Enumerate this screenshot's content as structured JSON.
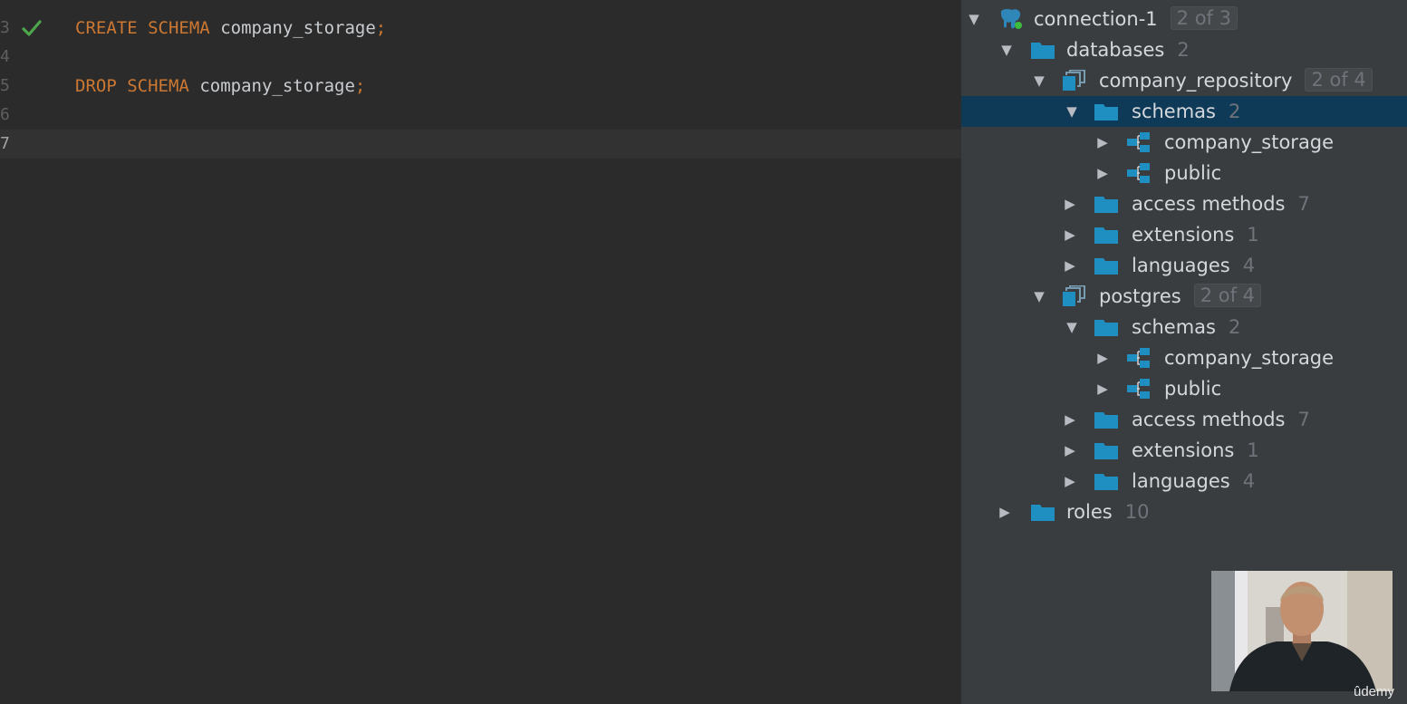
{
  "editor": {
    "lines": [
      {
        "num": "3",
        "keyword1": "CREATE",
        "keyword2": "SCHEMA",
        "identifier": "company_storage",
        "punct": ";",
        "status": "executed"
      },
      {
        "num": "4"
      },
      {
        "num": "5",
        "keyword1": "DROP",
        "keyword2": "SCHEMA",
        "identifier": "company_storage",
        "punct": ";"
      },
      {
        "num": "6"
      },
      {
        "num": "7"
      }
    ]
  },
  "tree": {
    "connection": {
      "label": "connection-1",
      "badge": "2 of 3"
    },
    "databases": {
      "label": "databases",
      "count": "2"
    },
    "db1": {
      "label": "company_repository",
      "badge": "2 of 4",
      "schemas": {
        "label": "schemas",
        "count": "2"
      },
      "schema1": "company_storage",
      "schema2": "public",
      "access_methods": {
        "label": "access methods",
        "count": "7"
      },
      "extensions": {
        "label": "extensions",
        "count": "1"
      },
      "languages": {
        "label": "languages",
        "count": "4"
      }
    },
    "db2": {
      "label": "postgres",
      "badge": "2 of 4",
      "schemas": {
        "label": "schemas",
        "count": "2"
      },
      "schema1": "company_storage",
      "schema2": "public",
      "access_methods": {
        "label": "access methods",
        "count": "7"
      },
      "extensions": {
        "label": "extensions",
        "count": "1"
      },
      "languages": {
        "label": "languages",
        "count": "4"
      }
    },
    "roles": {
      "label": "roles",
      "count": "10"
    }
  },
  "overlay": {
    "watermark": "ûdemy"
  },
  "colors": {
    "keyword": "#cc7832",
    "folder": "#1f8fc1",
    "selection": "#0e3a58",
    "check": "#4ca64c"
  }
}
